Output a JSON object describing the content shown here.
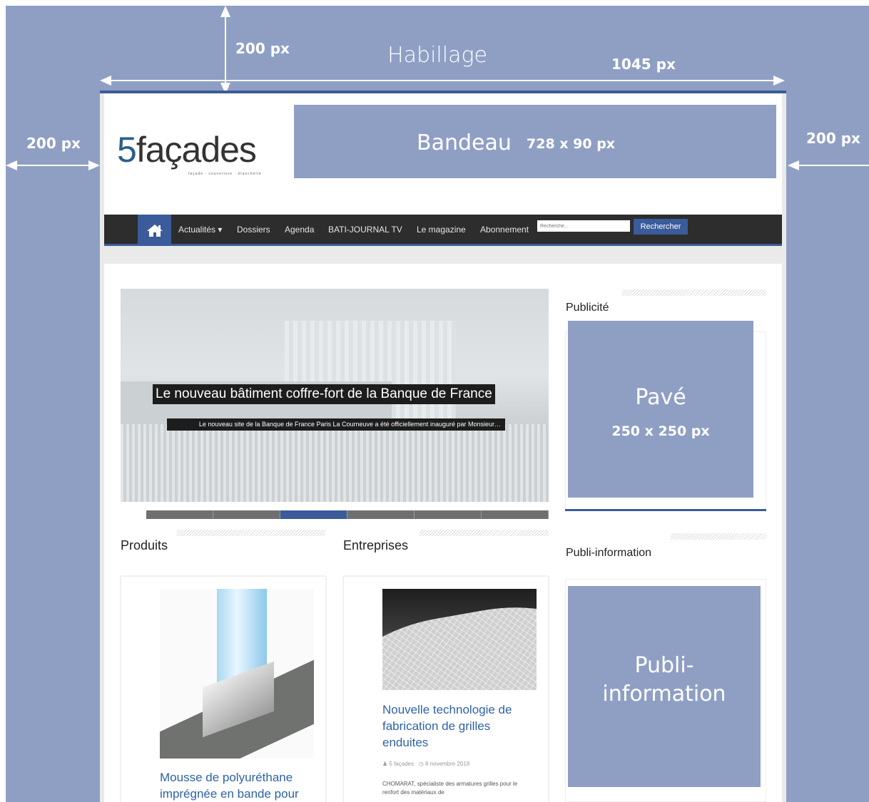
{
  "habillage": {
    "title": "Habillage",
    "top_margin": "200 px",
    "width": "1045 px",
    "left_margin": "200 px",
    "right_margin": "200 px"
  },
  "header": {
    "logo_number": "5",
    "logo_text": "façades",
    "logo_tagline": "façade · couverture · étanchéité",
    "bandeau_label": "Bandeau",
    "bandeau_size": "728 x 90 px"
  },
  "nav": {
    "items": [
      "Actualités ▾",
      "Dossiers",
      "Agenda",
      "BATI-JOURNAL TV",
      "Le magazine",
      "Abonnement"
    ],
    "search_placeholder": "Recherche...",
    "search_button": "Rechercher"
  },
  "slider": {
    "title": "Le nouveau bâtiment coffre-fort de la Banque de France",
    "description": "Le nouveau site de la Banque de France Paris La Courneuve a été officiellement inauguré par Monsieur…",
    "slide_count": 6,
    "active_slide": 3
  },
  "produits": {
    "section_title": "Produits",
    "card_title": "Mousse de polyuréthane imprégnée en bande pour"
  },
  "entreprises": {
    "section_title": "Entreprises",
    "card_title": "Nouvelle technologie de fabrication de grilles enduites",
    "author": "5 façades",
    "date": "8 novembre 2018",
    "excerpt": "CHOMARAT, spécialiste des armatures grilles pour le renfort des matériaux de"
  },
  "sidebar": {
    "pub_label": "Publicité",
    "pave_label": "Pavé",
    "pave_size": "250 x 250 px",
    "publi_label": "Publi-information",
    "publi_box_line1": "Publi-",
    "publi_box_line2": "information"
  },
  "colors": {
    "ad_placeholder": "#8f9fc4",
    "brand_blue": "#3b5b9a",
    "nav_bg": "#2d2d2d",
    "link_blue": "#2d62a8"
  }
}
